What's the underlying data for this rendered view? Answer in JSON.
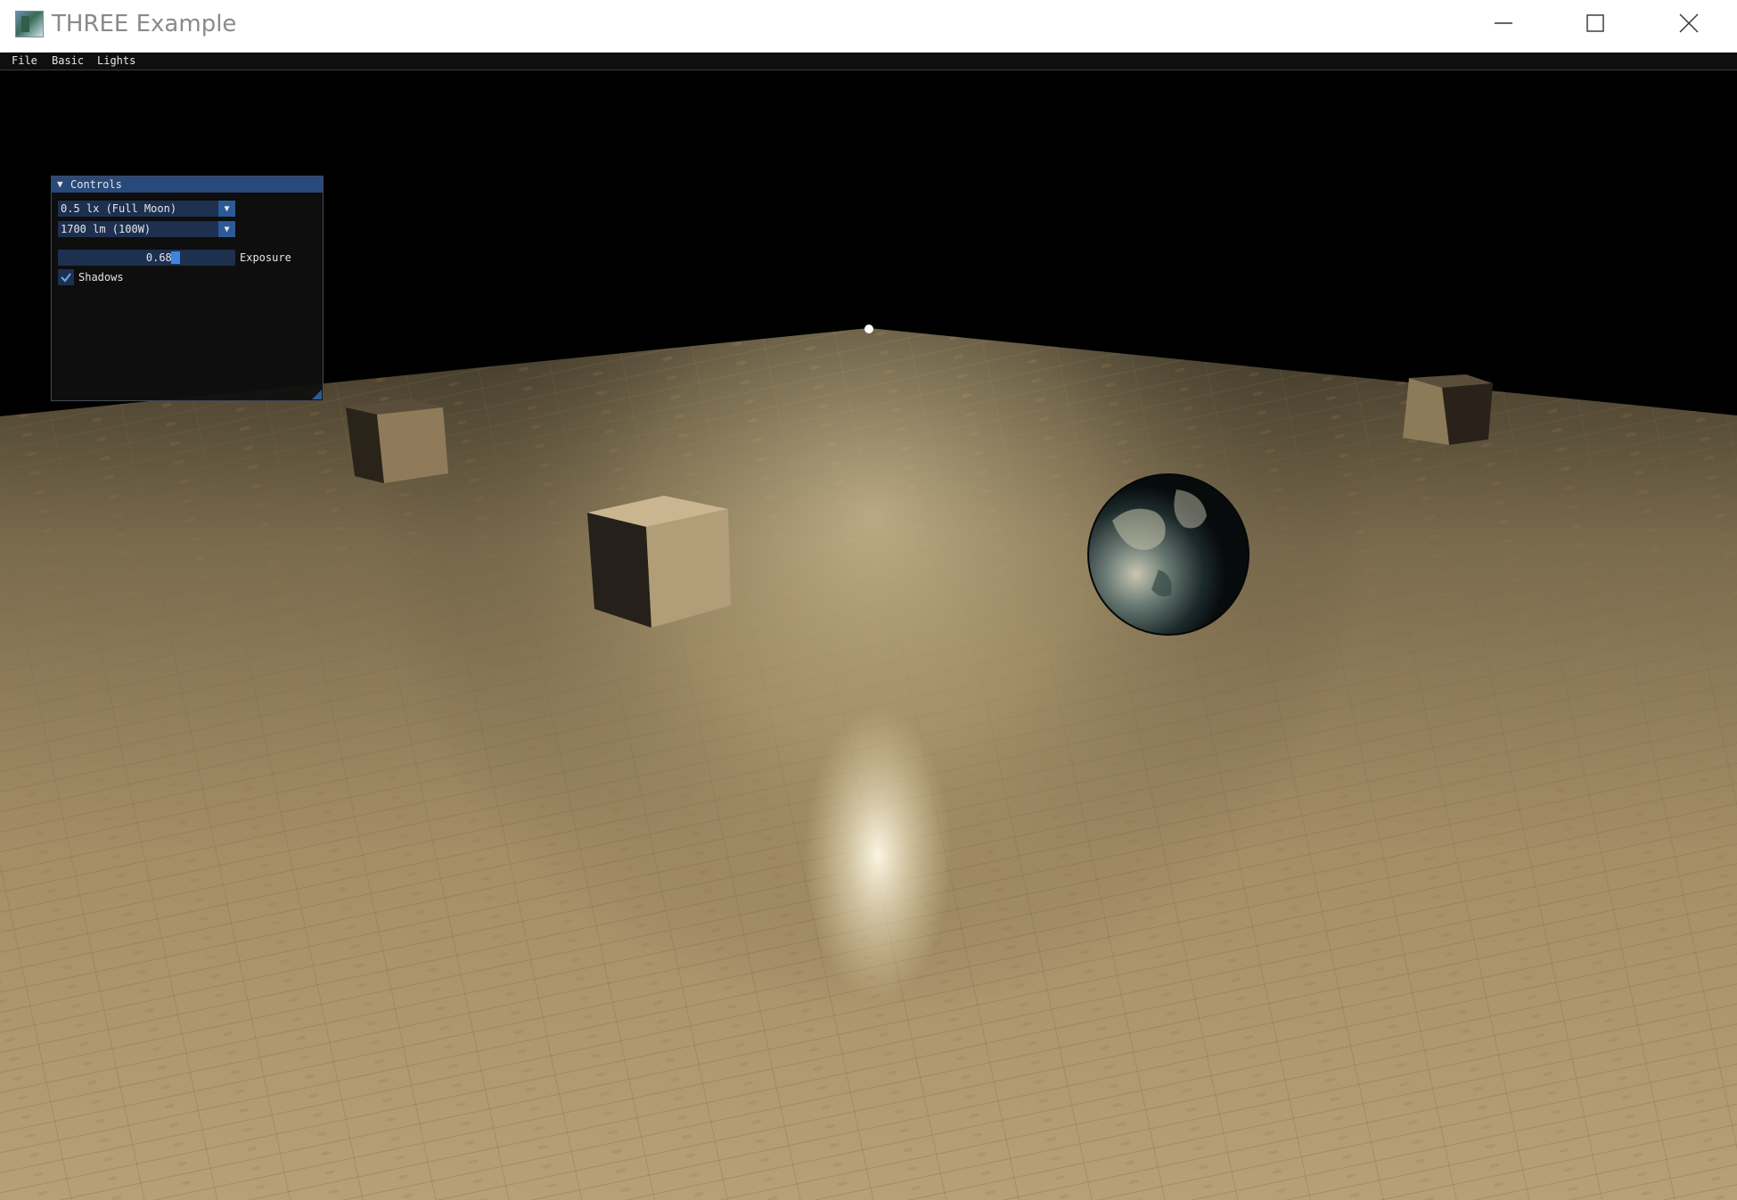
{
  "window": {
    "title": "THREE Example",
    "icon": "app-icon",
    "controls": [
      "minimize-icon",
      "maximize-icon",
      "close-icon"
    ]
  },
  "menubar": {
    "items": [
      {
        "label": "File"
      },
      {
        "label": "Basic"
      },
      {
        "label": "Lights"
      }
    ]
  },
  "controls_panel": {
    "title": "Controls",
    "collapse_icon": "collapse-triangle-icon",
    "ambient_combo": {
      "value": "0.5 lx (Full Moon)",
      "icon": "dropdown-arrow-icon"
    },
    "bulb_combo": {
      "value": "1700 lm (100W)",
      "icon": "dropdown-arrow-icon"
    },
    "exposure_slider": {
      "value": "0.680",
      "label": "Exposure"
    },
    "shadows_checkbox": {
      "label": "Shadows",
      "checked": true,
      "icon": "checkmark-icon"
    }
  },
  "scene": {
    "floor": "wooden-floor",
    "objects": [
      "light-bulb",
      "small-cube-left",
      "small-cube-right",
      "center-cube",
      "earth-sphere"
    ]
  },
  "colors": {
    "menubar_bg": "#0f0f0f",
    "panel_bg": "#0f0f0f",
    "panel_title": "#29497a",
    "widget_bg": "#1d3050",
    "accent": "#3d85e0",
    "floor": "#b59d73"
  }
}
